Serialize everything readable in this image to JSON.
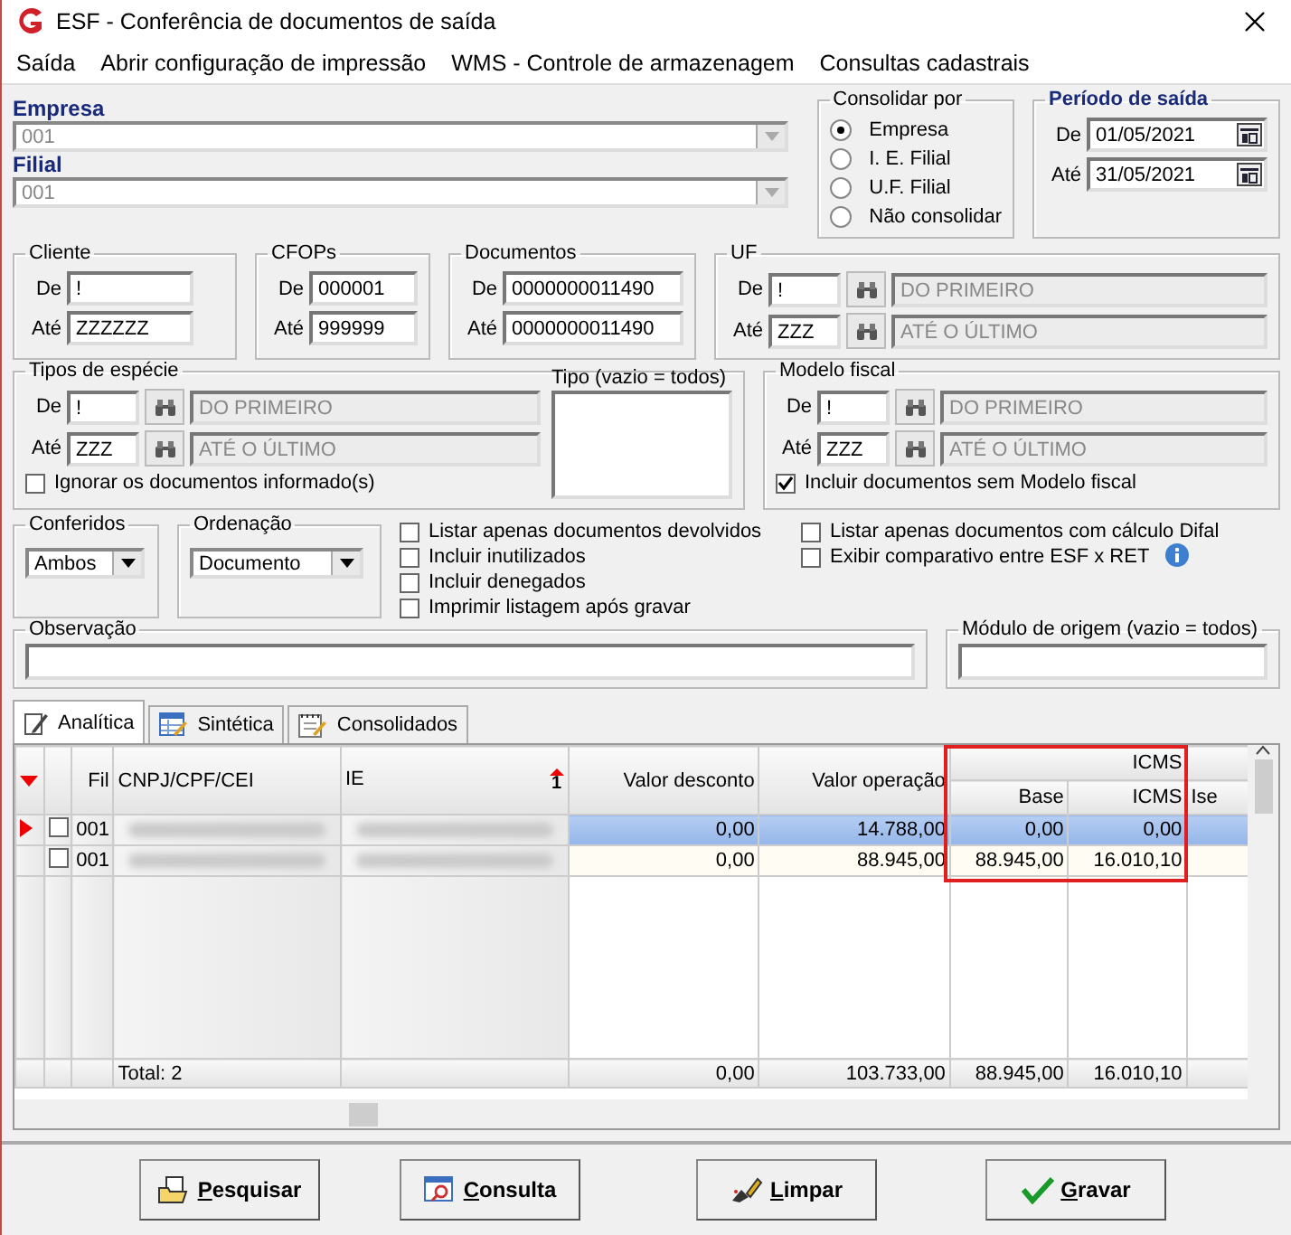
{
  "window": {
    "title": "ESF - Conferência de documentos de saída"
  },
  "menu": [
    "Saída",
    "Abrir configuração de impressão",
    "WMS - Controle de armazenagem",
    "Consultas cadastrais"
  ],
  "empresa": {
    "label": "Empresa",
    "value": "001"
  },
  "filial": {
    "label": "Filial",
    "value": "001"
  },
  "consolidar": {
    "title": "Consolidar por",
    "options": [
      {
        "label": "Empresa",
        "selected": true
      },
      {
        "label": "I. E. Filial",
        "selected": false
      },
      {
        "label": "U.F. Filial",
        "selected": false
      },
      {
        "label": "Não consolidar",
        "selected": false
      }
    ]
  },
  "periodo": {
    "title": "Período de saída",
    "rows": [
      {
        "label": "De",
        "value": "01/05/2021"
      },
      {
        "label": "Até",
        "value": "31/05/2021"
      }
    ]
  },
  "cliente": {
    "title": "Cliente",
    "rows": [
      {
        "label": "De",
        "value": "!"
      },
      {
        "label": "Até",
        "value": "ZZZZZZ"
      }
    ]
  },
  "cfops": {
    "title": "CFOPs",
    "rows": [
      {
        "label": "De",
        "value": "000001"
      },
      {
        "label": "Até",
        "value": "999999"
      }
    ]
  },
  "documentos": {
    "title": "Documentos",
    "rows": [
      {
        "label": "De",
        "value": "0000000011490"
      },
      {
        "label": "Até",
        "value": "0000000011490"
      }
    ]
  },
  "uf": {
    "title": "UF",
    "rows": [
      {
        "label": "De",
        "value": "!",
        "desc": "DO PRIMEIRO"
      },
      {
        "label": "Até",
        "value": "ZZZ",
        "desc": "ATÉ O ÚLTIMO"
      }
    ]
  },
  "tipos_especie": {
    "title": "Tipos de espécie",
    "rows": [
      {
        "label": "De",
        "value": "!",
        "desc": "DO PRIMEIRO"
      },
      {
        "label": "Até",
        "value": "ZZZ",
        "desc": "ATÉ O ÚLTIMO"
      }
    ],
    "checkbox": {
      "label": "Ignorar os documentos informado(s)",
      "checked": false
    }
  },
  "tipo": {
    "title": "Tipo (vazio = todos)"
  },
  "modelo_fiscal": {
    "title": "Modelo fiscal",
    "rows": [
      {
        "label": "De",
        "value": "!",
        "desc": "DO PRIMEIRO"
      },
      {
        "label": "Até",
        "value": "ZZZ",
        "desc": "ATÉ O ÚLTIMO"
      }
    ],
    "checkbox": {
      "label": "Incluir documentos sem Modelo fiscal",
      "checked": true
    }
  },
  "conferidos": {
    "title": "Conferidos",
    "value": "Ambos"
  },
  "ordenacao": {
    "title": "Ordenação",
    "value": "Documento"
  },
  "options_left": [
    {
      "label": "Listar apenas documentos devolvidos",
      "checked": false
    },
    {
      "label": "Incluir inutilizados",
      "checked": false
    },
    {
      "label": "Incluir denegados",
      "checked": false
    },
    {
      "label": "Imprimir listagem após gravar",
      "checked": false
    }
  ],
  "options_right": [
    {
      "label": "Listar apenas documentos com cálculo Difal",
      "checked": false
    },
    {
      "label": "Exibir comparativo entre ESF x  RET",
      "checked": false
    }
  ],
  "observacao": {
    "title": "Observação"
  },
  "modulo": {
    "title": "Módulo de origem (vazio = todos)"
  },
  "tabs": [
    {
      "label": "Analítica",
      "selected": true
    },
    {
      "label": "Sintética",
      "selected": false
    },
    {
      "label": "Consolidados",
      "selected": false
    }
  ],
  "table": {
    "group": {
      "label": "ICMS",
      "highlighted": true
    },
    "columns": [
      "Fil",
      "CNPJ/CPF/CEI",
      "IE",
      "Valor desconto",
      "Valor operação",
      "Base",
      "ICMS",
      "Ise"
    ],
    "sort": "1",
    "rows": [
      {
        "selected": true,
        "checked": false,
        "fil": "001",
        "redacted": true,
        "values": [
          "0,00",
          "14.788,00",
          "0,00",
          "0,00"
        ]
      },
      {
        "selected": false,
        "checked": false,
        "fil": "001",
        "redacted": true,
        "values": [
          "0,00",
          "88.945,00",
          "88.945,00",
          "16.010,10"
        ]
      }
    ],
    "total": {
      "label": "Total: 2",
      "values": [
        "0,00",
        "103.733,00",
        "88.945,00",
        "16.010,10"
      ]
    }
  },
  "buttons": [
    "Pesquisar",
    "Consulta",
    "Limpar",
    "Gravar"
  ]
}
